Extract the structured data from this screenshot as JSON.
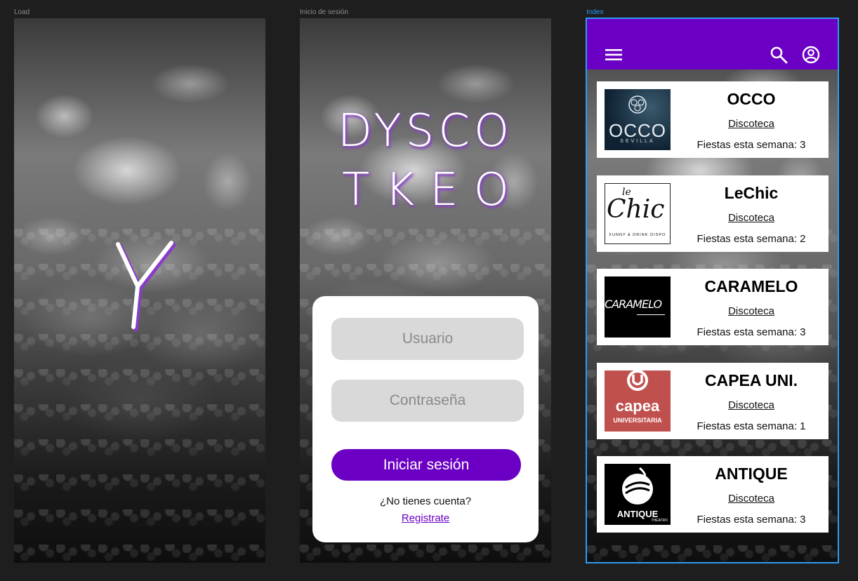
{
  "frames": {
    "load": {
      "label": "Load"
    },
    "login": {
      "label": "Inicio de sesión"
    },
    "index": {
      "label": "Index"
    }
  },
  "load": {
    "logo_letter": "Y"
  },
  "login": {
    "brand_line1": "DYSCO",
    "brand_line2": "TKEO",
    "username_placeholder": "Usuario",
    "password_placeholder": "Contraseña",
    "login_button": "Iniciar sesión",
    "no_account_text": "¿No tienes cuenta?",
    "register_link": "Registrate"
  },
  "index": {
    "menu_icon": "hamburger-menu-icon",
    "search_icon": "search-icon",
    "account_icon": "account-circle-icon",
    "venues": [
      {
        "name": "OCCO",
        "type": "Discoteca",
        "parties": "Fiestas esta semana: 3",
        "logo_text": "OCCO",
        "logo_sub": "SEVILLA"
      },
      {
        "name": "LeChic",
        "type": "Discoteca",
        "parties": "Fiestas esta semana: 2",
        "logo_text": "Chic",
        "logo_sub": "FUNNY & DRINK·DISPO"
      },
      {
        "name": "CARAMELO",
        "type": "Discoteca",
        "parties": "Fiestas esta semana: 3",
        "logo_text": "CARAMELO"
      },
      {
        "name": "CAPEA UNI.",
        "type": "Discoteca",
        "parties": "Fiestas esta semana: 1",
        "logo_text": "capea",
        "logo_sub": "UNIVERSITARIA"
      },
      {
        "name": "ANTIQUE",
        "type": "Discoteca",
        "parties": "Fiestas esta semana: 3",
        "logo_text": "ANTIQUE",
        "logo_sub": "THEATRO"
      }
    ]
  },
  "colors": {
    "accent_purple": "#6b00c4",
    "input_grey": "#d9d9d9",
    "canvas": "#1e1e1e",
    "selection_blue": "#2c9cf5"
  }
}
